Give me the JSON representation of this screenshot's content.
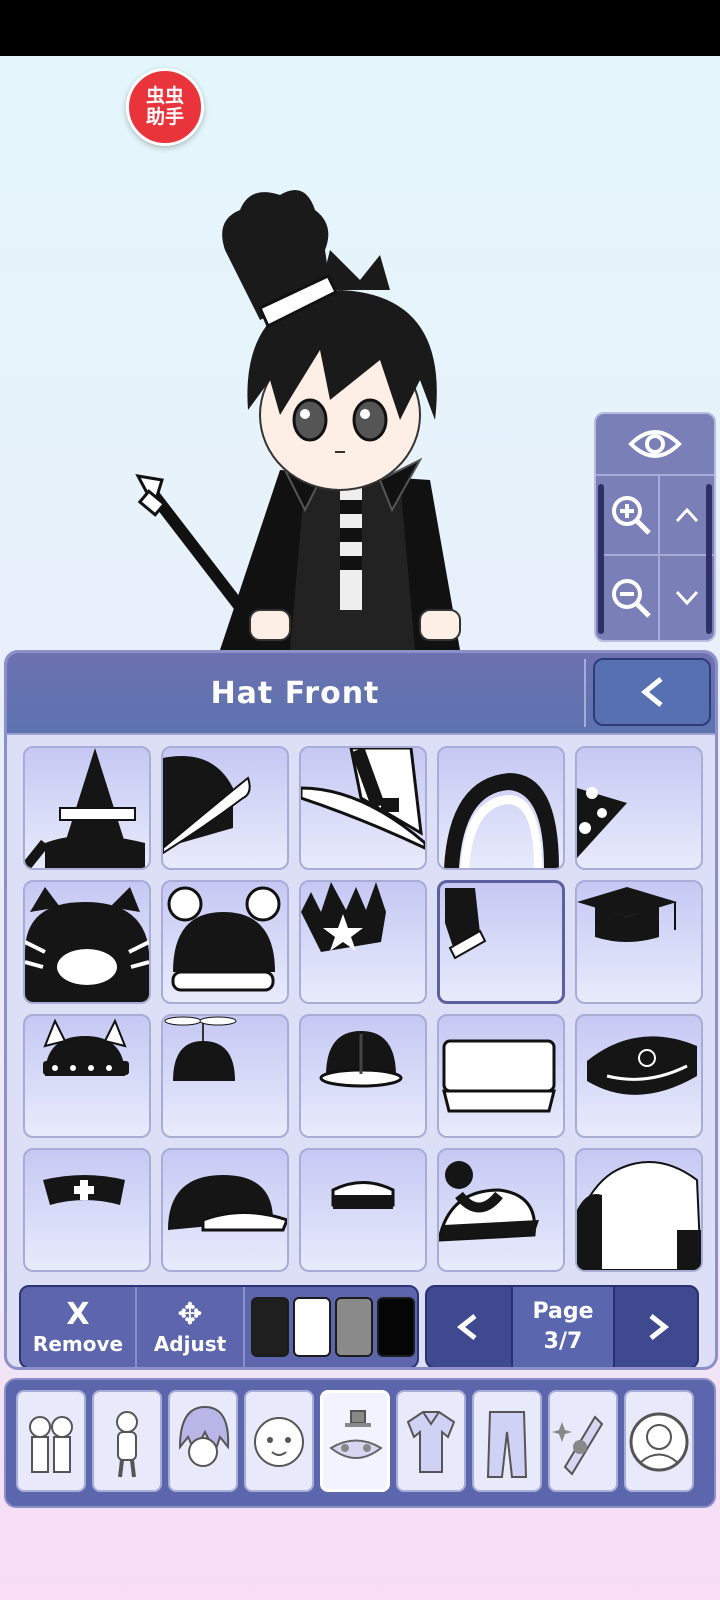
{
  "overlay": {
    "helper_badge_text": "虫虫\n助手"
  },
  "panel": {
    "title": "Hat Front",
    "back_glyph": "<"
  },
  "view_controls": {
    "eye": "eye-icon",
    "zoom_in": "zoom-in-icon",
    "up": "chevron-up-icon",
    "zoom_out": "zoom-out-icon",
    "down": "chevron-down-icon"
  },
  "items": [
    "witch-hat",
    "black-cap-white-rim",
    "white-fedora-striped",
    "black-headband",
    "polka-dot-cone",
    "cat-beanie-striped",
    "mouse-ear-hat",
    "spiky-star-crown",
    "small-black-side-hat",
    "graduation-cap",
    "viking-helmet",
    "propeller-beanie",
    "hard-hat",
    "white-visor-cap",
    "police-cap",
    "nurse-cap",
    "black-baseball-cap",
    "small-sailor-cap",
    "pompom-beanie",
    "fur-trapper-hat"
  ],
  "selected_item_index": 8,
  "toolbar": {
    "remove_glyph": "X",
    "remove_label": "Remove",
    "adjust_glyph": "✥",
    "adjust_label": "Adjust",
    "swatches": [
      "#1f1f1f",
      "#ffffff",
      "#8a8a8a",
      "#050505"
    ]
  },
  "pagination": {
    "page_label": "Page",
    "page_value": "3/7",
    "prev_glyph": "<",
    "next_glyph": ">"
  },
  "categories": [
    "presets-icon",
    "body-icon",
    "hair-icon",
    "face-icon",
    "accessories-icon",
    "top-clothing-icon",
    "bottom-clothing-icon",
    "items-icon",
    "profile-icon"
  ],
  "active_category_index": 4,
  "colors": {
    "panel_header": "#6d71b0",
    "panel_bg": "#dcdff6",
    "toolbar": "#5d65ad",
    "pagination": "#3e4990",
    "badge": "#e8343a"
  }
}
